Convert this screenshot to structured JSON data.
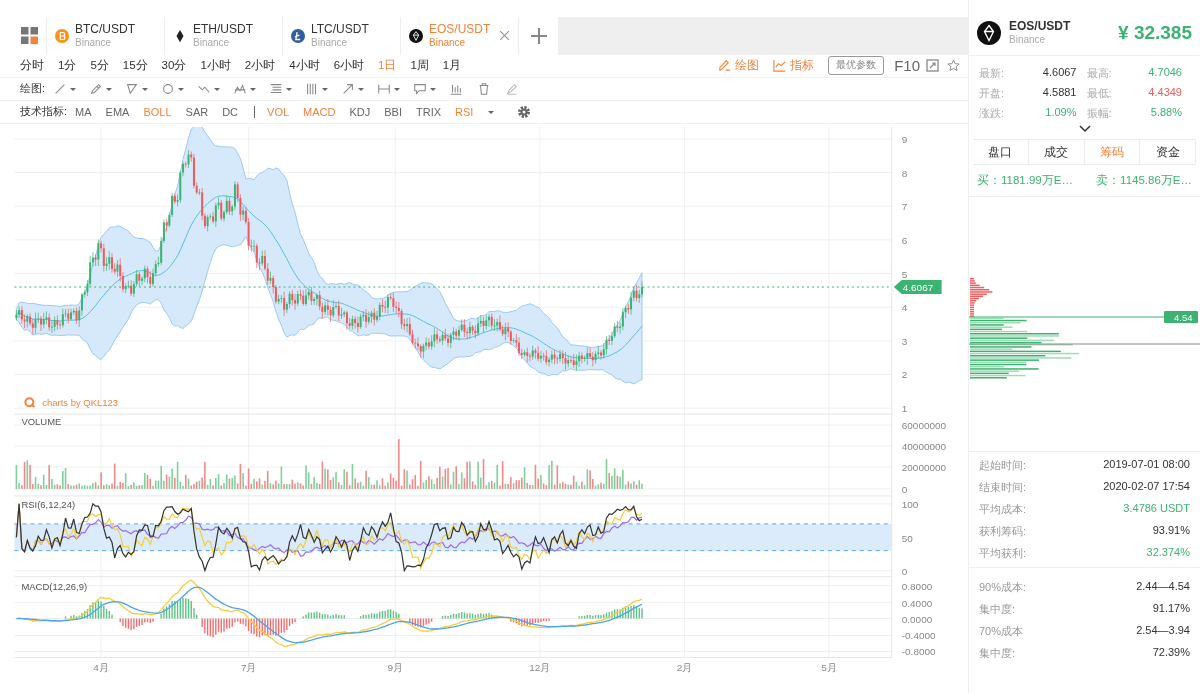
{
  "tabs": [
    {
      "symbol": "BTC/USDT",
      "exchange": "Binance",
      "kind": "btc",
      "selected": false,
      "closable": false
    },
    {
      "symbol": "ETH/USDT",
      "exchange": "Binance",
      "kind": "eth",
      "selected": false,
      "closable": false
    },
    {
      "symbol": "LTC/USDT",
      "exchange": "Binance",
      "kind": "ltc",
      "selected": false,
      "closable": false
    },
    {
      "symbol": "EOS/USDT",
      "exchange": "Binance",
      "kind": "eos",
      "selected": true,
      "closable": true
    }
  ],
  "periods": [
    {
      "label": "分时",
      "selected": false
    },
    {
      "label": "1分",
      "selected": false
    },
    {
      "label": "5分",
      "selected": false
    },
    {
      "label": "15分",
      "selected": false
    },
    {
      "label": "30分",
      "selected": false
    },
    {
      "label": "1小时",
      "selected": false
    },
    {
      "label": "2小时",
      "selected": false
    },
    {
      "label": "4小时",
      "selected": false
    },
    {
      "label": "6小时",
      "selected": false
    },
    {
      "label": "1日",
      "selected": true
    },
    {
      "label": "1周",
      "selected": false
    },
    {
      "label": "1月",
      "selected": false
    }
  ],
  "chart_actions": [
    {
      "label": "绘图",
      "kind": "draw"
    },
    {
      "label": "指标",
      "kind": "indicator"
    }
  ],
  "optimal_params": "最优参数",
  "f10": "F10",
  "drawing_tools": {
    "label": "绘图:",
    "tools": [
      {
        "kind": "line",
        "dropdown": true
      },
      {
        "kind": "pen",
        "dropdown": true
      },
      {
        "kind": "triangle",
        "dropdown": true
      },
      {
        "kind": "circle",
        "dropdown": true
      },
      {
        "kind": "wave",
        "dropdown": true
      },
      {
        "kind": "pattern",
        "dropdown": true
      },
      {
        "kind": "fib",
        "dropdown": true
      },
      {
        "kind": "vlines",
        "dropdown": true
      },
      {
        "kind": "arrow",
        "dropdown": true
      },
      {
        "kind": "measure",
        "dropdown": true
      },
      {
        "kind": "comment",
        "dropdown": true
      },
      {
        "kind": "bars",
        "dropdown": false
      },
      {
        "kind": "trash",
        "dropdown": false
      },
      {
        "kind": "eraser",
        "dropdown": false
      }
    ]
  },
  "indicators": {
    "label": "技术指标:",
    "main": [
      {
        "label": "MA",
        "selected": false
      },
      {
        "label": "EMA",
        "selected": false
      },
      {
        "label": "BOLL",
        "selected": true
      },
      {
        "label": "SAR",
        "selected": false
      },
      {
        "label": "DC",
        "selected": false
      }
    ],
    "sub": [
      {
        "label": "VOL",
        "selected": true
      },
      {
        "label": "MACD",
        "selected": true
      },
      {
        "label": "KDJ",
        "selected": false
      },
      {
        "label": "BBI",
        "selected": false
      },
      {
        "label": "TRIX",
        "selected": false
      },
      {
        "label": "RSI",
        "selected": true
      }
    ]
  },
  "chart": {
    "price_axis": [
      "9",
      "8",
      "7",
      "6",
      "5",
      "4",
      "3",
      "2",
      "1"
    ],
    "last_price": "4.6067",
    "credit": "charts by QKL123",
    "volume": {
      "title": "VOLUME",
      "axis": [
        "60000000",
        "40000000",
        "20000000",
        "0"
      ]
    },
    "rsi": {
      "title": "RSI(6,12,24)",
      "axis": [
        "100",
        "50",
        "0"
      ]
    },
    "macd": {
      "title": "MACD(12,26,9)",
      "axis": [
        "0.8000",
        "0.4000",
        "0.0000",
        "-0.4000",
        "-0.8000"
      ]
    },
    "months": [
      "4月",
      "7月",
      "9月",
      "12月",
      "2月",
      "5月"
    ]
  },
  "quote": {
    "symbol": "EOS/USDT",
    "exchange": "Binance",
    "price": "¥ 32.385"
  },
  "stats": [
    {
      "label": "最新:",
      "value": "4.6067",
      "color": "#333333"
    },
    {
      "label": "最高:",
      "value": "4.7046",
      "color": "#3cb371"
    },
    {
      "label": "开盘:",
      "value": "4.5881",
      "color": "#333333"
    },
    {
      "label": "最低:",
      "value": "4.4349",
      "color": "#f05a5a"
    },
    {
      "label": "涨跌:",
      "value": "1.09%",
      "color": "#3cb371"
    },
    {
      "label": "振幅:",
      "value": "5.88%",
      "color": "#3cb371"
    }
  ],
  "panel_tabs": [
    {
      "label": "盘口",
      "selected": false
    },
    {
      "label": "成交",
      "selected": false
    },
    {
      "label": "筹码",
      "selected": true
    },
    {
      "label": "资金",
      "selected": false
    }
  ],
  "buy": "买：1181.99万E…",
  "sell": "卖：1145.86万E…",
  "chips": {
    "price_tag": "4.54"
  },
  "chip_stats": [
    {
      "label": "起始时间:",
      "value": "2019-07-01 08:00",
      "highlight": false
    },
    {
      "label": "结束时间:",
      "value": "2020-02-07 17:54",
      "highlight": false
    },
    {
      "label": "平均成本:",
      "value": "3.4786 USDT",
      "highlight": true
    },
    {
      "label": "获利筹码:",
      "value": "93.91%",
      "highlight": false
    },
    {
      "label": "平均获利:",
      "value": "32.374%",
      "highlight": true
    }
  ],
  "cost_stats": [
    {
      "label": "90%成本:",
      "value": "2.44—4.54"
    },
    {
      "label": "集中度:",
      "value": "91.17%"
    },
    {
      "label": "70%成本",
      "value": "2.54—3.94"
    },
    {
      "label": "集中度:",
      "value": "72.39%"
    }
  ]
}
